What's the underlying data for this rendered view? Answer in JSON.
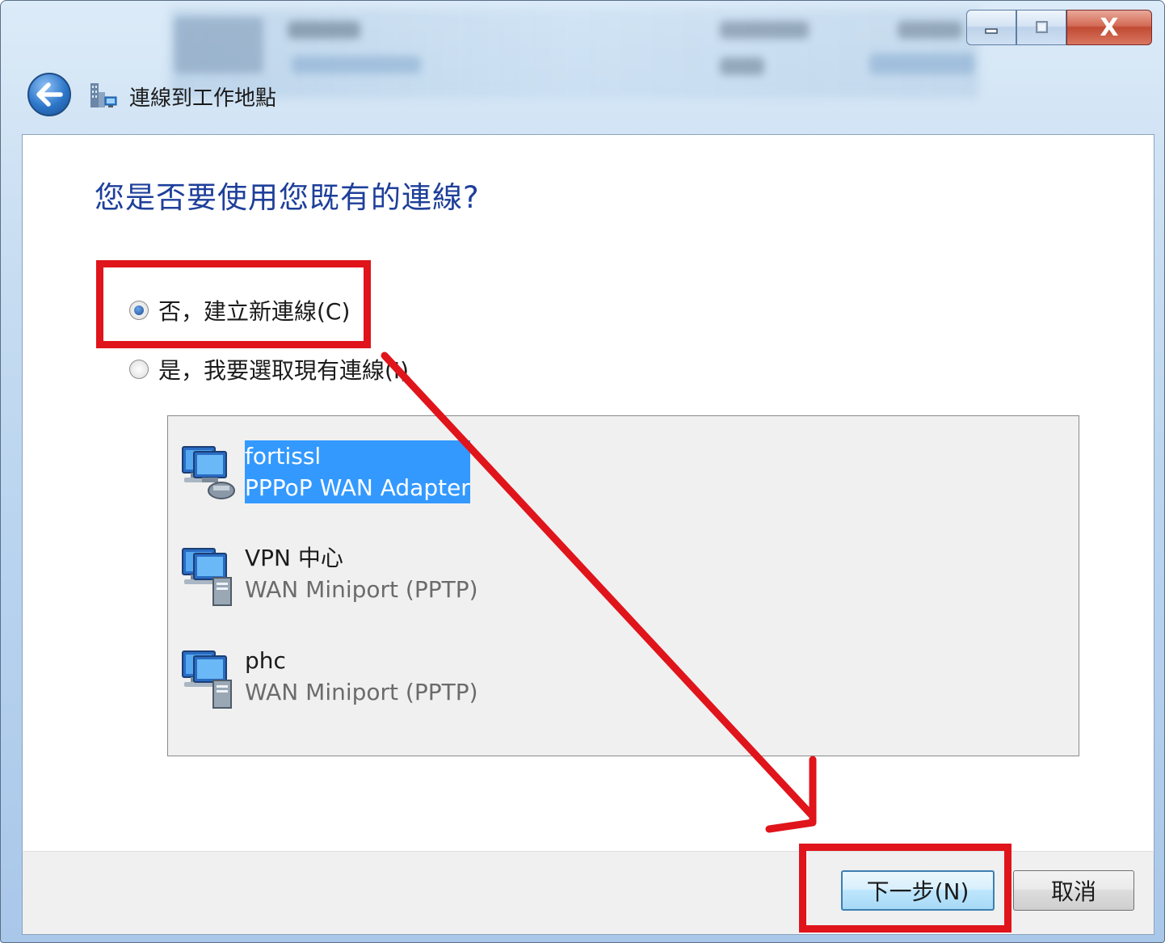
{
  "window": {
    "title": "連線到工作地點",
    "caption_buttons": {
      "minimize": "minimize",
      "maximize": "maximize",
      "close": "X"
    }
  },
  "wizard": {
    "heading": "您是否要使用您既有的連線?",
    "options": [
      {
        "label": "否，建立新連線(C)",
        "selected": true
      },
      {
        "label": "是，我要選取現有連線(I)",
        "selected": false
      }
    ],
    "connections": [
      {
        "name": "fortissl",
        "device": "PPPoP WAN Adapter",
        "selected": true,
        "icon": "network-dialup-icon"
      },
      {
        "name": "VPN 中心",
        "device": "WAN Miniport (PPTP)",
        "selected": false,
        "icon": "network-vpn-icon"
      },
      {
        "name": "phc",
        "device": "WAN Miniport (PPTP)",
        "selected": false,
        "icon": "network-vpn-icon"
      }
    ]
  },
  "footer": {
    "next_label": "下一步(N)",
    "cancel_label": "取消"
  },
  "annotation": {
    "color": "#e0141b"
  }
}
